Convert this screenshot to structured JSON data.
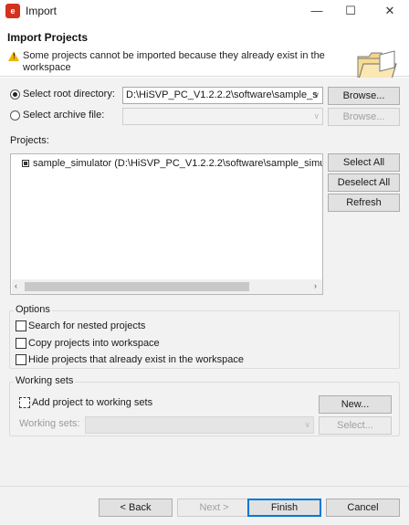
{
  "window": {
    "app_icon": "eclipse-app-icon",
    "title": "Import",
    "minimize": "—",
    "maximize": "☐",
    "close": "✕"
  },
  "banner": {
    "title": "Import Projects",
    "message": "Some projects cannot be imported because they already exist in the workspace",
    "icons": [
      "warning-icon",
      "folder-icon"
    ]
  },
  "source": {
    "root_dir_label": "Select root directory:",
    "root_dir_value": "D:\\HiSVP_PC_V1.2.2.2\\software\\sample_s",
    "archive_label": "Select archive file:",
    "archive_value": "",
    "browse_label": "Browse...",
    "browse_disabled_label": "Browse...",
    "selected": "root_directory"
  },
  "projects": {
    "label": "Projects:",
    "items": [
      {
        "text": "sample_simulator (D:\\HiSVP_PC_V1.2.2.2\\software\\sample_simul",
        "checked": true
      }
    ],
    "select_all": "Select All",
    "deselect_all": "Deselect All",
    "refresh": "Refresh"
  },
  "options": {
    "title": "Options",
    "search_nested": "Search for nested projects",
    "copy_into_workspace": "Copy projects into workspace",
    "hide_existing": "Hide projects that already exist in the workspace"
  },
  "working_sets": {
    "title": "Working sets",
    "add_label": "Add project to working sets",
    "new_button": "New...",
    "sets_label": "Working sets:",
    "select_button": "Select..."
  },
  "footer": {
    "back": "< Back",
    "next": "Next >",
    "finish": "Finish",
    "cancel": "Cancel"
  },
  "colors": {
    "accent": "#0078d7",
    "warning": "#f0b400",
    "app_icon": "#d4311f"
  }
}
